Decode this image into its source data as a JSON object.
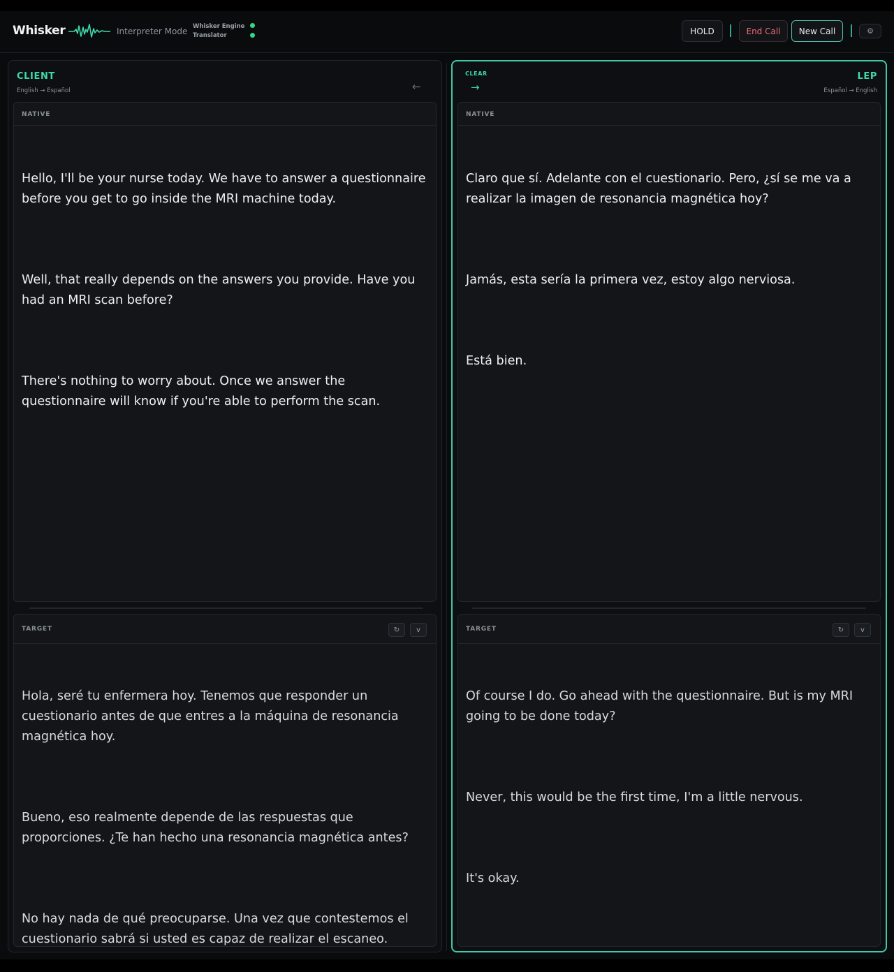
{
  "header": {
    "brand": "Whisker",
    "mode": "Interpreter Mode",
    "engine_line1": "Whisker Engine",
    "engine_line2": "Translator",
    "hold_label": "HOLD",
    "end_call_label": "End Call",
    "new_call_label": "New Call",
    "settings_icon": "⚙"
  },
  "client": {
    "title": "CLIENT",
    "languages": "English → Español",
    "arrow": "←",
    "native_label": "NATIVE",
    "native_text": [
      "Hello, I'll be your nurse today. We have to answer a questionnaire before you get to go inside the MRI machine today.",
      "Well, that really depends on the answers you provide. Have you had an MRI scan before?",
      "There's nothing to worry about. Once we answer the questionnaire will know if you're able to perform the scan."
    ],
    "target_label": "TARGET",
    "target_text": [
      "Hola, seré tu enfermera hoy. Tenemos que responder un cuestionario antes de que entres a la máquina de resonancia magnética hoy.",
      "Bueno, eso realmente depende de las respuestas que proporciones. ¿Te han hecho una resonancia magnética antes?",
      "No hay nada de qué preocuparse. Una vez que contestemos el cuestionario sabrá si usted es capaz de realizar el escaneo."
    ]
  },
  "lep": {
    "clear_label": "CLEAR",
    "arrow": "→",
    "title": "LEP",
    "languages": "Español → English",
    "native_label": "NATIVE",
    "native_text": [
      "Claro que sí. Adelante con el cuestionario. Pero, ¿sí se me va a realizar la imagen de resonancia magnética hoy?",
      "Jamás, esta sería la primera vez, estoy algo nerviosa.",
      "Está bien."
    ],
    "target_label": "TARGET",
    "target_text": [
      "Of course I do. Go ahead with the questionnaire. But is my MRI going to be done today?",
      "Never, this would be the first time, I'm a little nervous.",
      "It's okay."
    ]
  },
  "icons": {
    "refresh": "↻",
    "collapse": "v"
  },
  "colors": {
    "accent": "#3fd9a9",
    "panel_border_active": "#41c8a8",
    "end_call": "#f06d79",
    "status_dot": "#35d686"
  }
}
